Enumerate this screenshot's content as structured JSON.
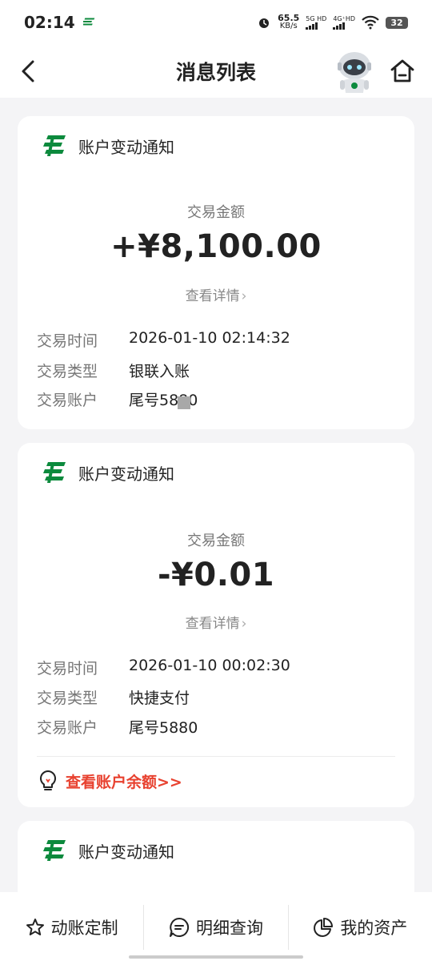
{
  "status": {
    "time": "02:14",
    "speed_value": "65.5",
    "speed_unit": "KB/s",
    "net1": "5G HD",
    "net2": "4G⁺HD",
    "battery": "32"
  },
  "header": {
    "title": "消息列表"
  },
  "cards": [
    {
      "title": "账户变动通知",
      "amount_label": "交易金额",
      "amount": "+¥8,100.00",
      "detail": "查看详情",
      "rows": [
        {
          "k": "交易时间",
          "v": "2026-01-10 02:14:32"
        },
        {
          "k": "交易类型",
          "v": "银联入账"
        },
        {
          "k": "交易账户",
          "v": "尾号5880"
        }
      ]
    },
    {
      "title": "账户变动通知",
      "amount_label": "交易金额",
      "amount": "-¥0.01",
      "detail": "查看详情",
      "rows": [
        {
          "k": "交易时间",
          "v": "2026-01-10 00:02:30"
        },
        {
          "k": "交易类型",
          "v": "快捷支付"
        },
        {
          "k": "交易账户",
          "v": "尾号5880"
        }
      ],
      "balance_link": "查看账户余额>>"
    },
    {
      "title": "账户变动通知"
    }
  ],
  "bottom": {
    "tab1": "动账定制",
    "tab2": "明细查询",
    "tab3": "我的资产"
  },
  "colors": {
    "brand_green": "#0c8a3d",
    "accent_red": "#e8412f"
  }
}
